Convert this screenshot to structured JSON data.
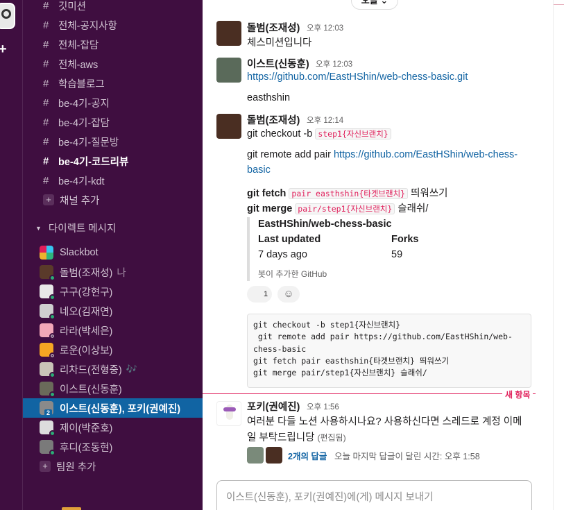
{
  "workspace": {
    "icon": "workspace-icon",
    "add_label": "+"
  },
  "sidebar": {
    "channels": [
      {
        "label": "깃미션",
        "bold": false
      },
      {
        "label": "전체-공지사항",
        "bold": false
      },
      {
        "label": "전체-잡담",
        "bold": false
      },
      {
        "label": "전체-aws",
        "bold": false
      },
      {
        "label": "학습블로그",
        "bold": false
      },
      {
        "label": "be-4기-공지",
        "bold": false
      },
      {
        "label": "be-4기-잡담",
        "bold": false
      },
      {
        "label": "be-4기-질문방",
        "bold": false
      },
      {
        "label": "be-4기-코드리뷰",
        "bold": true
      },
      {
        "label": "be-4기-kdt",
        "bold": false
      }
    ],
    "hash": "#",
    "add_channel": "채널 추가",
    "dm_header": "다이렉트 메시지",
    "dms": [
      {
        "label": "Slackbot"
      },
      {
        "label": "돌범(조재성)",
        "suffix": "나"
      },
      {
        "label": "구구(강현구)"
      },
      {
        "label": "네오(김재연)"
      },
      {
        "label": "라라(박세은)"
      },
      {
        "label": "로운(이상보)"
      },
      {
        "label": "리차드(전형중)",
        "status_emoji": "🎶"
      },
      {
        "label": "이스트(신동훈)"
      },
      {
        "label": "이스트(신동훈), 포키(권예진)",
        "badge": "2",
        "active": true
      },
      {
        "label": "제이(박준호)"
      },
      {
        "label": "후디(조동현)"
      }
    ],
    "add_member": "팀원 추가",
    "colors": {
      "bg": "#3f0e40",
      "active": "#1164a3"
    }
  },
  "main": {
    "date_pill": "오늘 ⌄",
    "messages": [
      {
        "sender": "돌범(조재성)",
        "time": "오후 12:03",
        "lines": [
          "체스미션입니다"
        ]
      },
      {
        "sender": "이스트(신동훈)",
        "time": "오후 12:03",
        "link": "https://github.com/EastHShin/web-chess-basic.git",
        "line2": "easthshin"
      },
      {
        "sender": "돌범(조재성)",
        "time": "오후 12:14",
        "l1_pre": "git checkout -b ",
        "l1_code": "step1{자신브랜치}",
        "l2_pre": " git remote add pair ",
        "l2_link_a": "https://github.com/EastHShin/web-chess-",
        "l2_link_b": "basic",
        "l3_cmd": "git fetch",
        "l3_code": "pair easthshin{타겟브랜치}",
        "l3_post": " 띄워쓰기",
        "l4_cmd": "git merge",
        "l4_code": "pair/step1{자신브랜치}",
        "l4_post": " 슬래쉬/"
      }
    ],
    "unfurl": {
      "title": "EastHShin/web-chess-basic",
      "col1_label": "Last updated",
      "col1_value": "7 days ago",
      "col2_label": "Forks",
      "col2_value": "59",
      "footer": "봇이 추가한 GitHub"
    },
    "reaction": {
      "count": "1",
      "add_icon": "add-reaction-icon"
    },
    "codeblock": "git checkout -b step1{자신브랜치}\n git remote add pair https://github.com/EastHShin/web-\nchess-basic\ngit fetch pair easthshin{타겟브랜치} 띄워쓰기\ngit merge pair/step1{자신브랜치} 슬래쉬/",
    "new_label": "새 항목",
    "last_message": {
      "sender": "포키(권예진)",
      "time": "오후 1:56",
      "line1": "여러분 다들 노션 사용하시나요? 사용하신다면 스레드로 계정 이메",
      "line2": "일 부탁드립니당",
      "edited": "(편집됨)",
      "thread_count": "2개의 답글",
      "thread_last": "오늘 마지막 답글이 달린 시간: 오후 1:58"
    },
    "composer_placeholder": "이스트(신동훈), 포키(권예진)에(게) 메시지 보내기",
    "colors": {
      "link": "#1264a3",
      "accent": "#e01e5a"
    }
  }
}
